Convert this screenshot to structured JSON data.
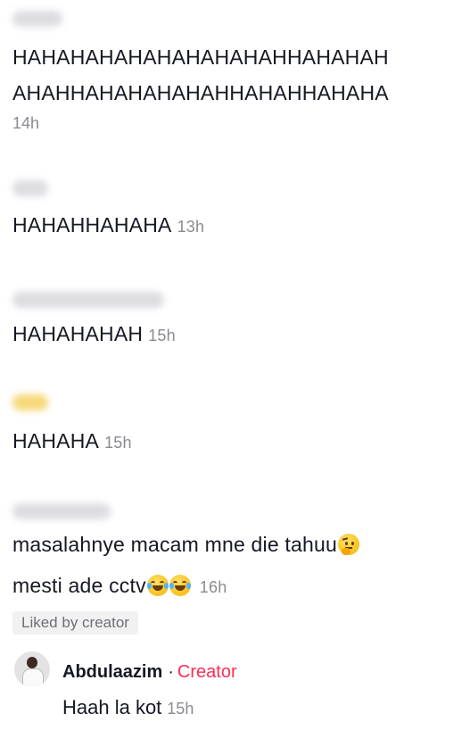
{
  "comments": [
    {
      "text_line1": "HAHAHAHAHAHAHAHAHAHHAHAHAH",
      "text_line2": "AHAHHAHAHAHAHAHHAHAHHAHAHA",
      "time": "14h"
    },
    {
      "text": "HAHAHHAHAHA",
      "time": "13h"
    },
    {
      "text": "HAHAHAHAH",
      "time": "15h"
    },
    {
      "text": "HAHAHA",
      "time": "15h"
    },
    {
      "text_line1": "masalahnye macam mne die tahuu",
      "text_line2": "mesti ade cctv",
      "time": "16h"
    }
  ],
  "liked_badge": "Liked by creator",
  "reply": {
    "author": "Abdulaazim",
    "separator": "·",
    "role": "Creator",
    "text": "Haah la kot",
    "time": "15h"
  },
  "icons": {
    "thinking": "thinking-face-emoji",
    "laughing": "face-with-tears-of-joy-emoji"
  }
}
